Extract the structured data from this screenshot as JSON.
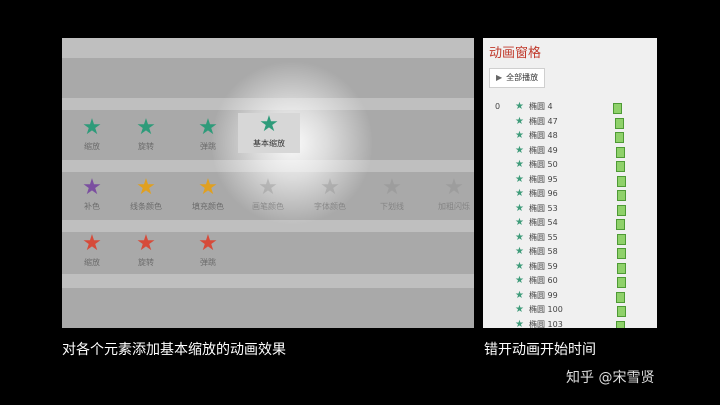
{
  "gallery": {
    "rows": [
      [
        {
          "label": "缩放",
          "color": "#2e9b7a"
        },
        {
          "label": "旋转",
          "color": "#2e9b7a"
        },
        {
          "label": "弹跳",
          "color": "#2e9b7a"
        }
      ],
      [
        {
          "label": "补色",
          "color": "#7b4fa0"
        },
        {
          "label": "线条颜色",
          "color": "#e0a020"
        },
        {
          "label": "填充颜色",
          "color": "#e0a020"
        },
        {
          "label": "画笔颜色",
          "color": "#888888"
        },
        {
          "label": "字体颜色",
          "color": "#888888"
        },
        {
          "label": "下划线",
          "color": "#888888"
        },
        {
          "label": "加粗闪烁",
          "color": "#888888"
        }
      ],
      [
        {
          "label": "缩放",
          "color": "#d64b3a"
        },
        {
          "label": "旋转",
          "color": "#d64b3a"
        },
        {
          "label": "弹跳",
          "color": "#d64b3a"
        }
      ]
    ],
    "highlighted": {
      "label": "基本缩放",
      "color": "#2e9b7a"
    }
  },
  "animation_pane": {
    "title": "动画窗格",
    "play_all": "全部播放",
    "items": [
      {
        "num": "0",
        "name": "椭圆 4",
        "bar": 0.05
      },
      {
        "num": "",
        "name": "椭圆 47",
        "bar": 0.1
      },
      {
        "num": "",
        "name": "椭圆 48",
        "bar": 0.1
      },
      {
        "num": "",
        "name": "椭圆 49",
        "bar": 0.12
      },
      {
        "num": "",
        "name": "椭圆 50",
        "bar": 0.12
      },
      {
        "num": "",
        "name": "椭圆 95",
        "bar": 0.14
      },
      {
        "num": "",
        "name": "椭圆 96",
        "bar": 0.16
      },
      {
        "num": "",
        "name": "椭圆 53",
        "bar": 0.14
      },
      {
        "num": "",
        "name": "椭圆 54",
        "bar": 0.12
      },
      {
        "num": "",
        "name": "椭圆 55",
        "bar": 0.14
      },
      {
        "num": "",
        "name": "椭圆 58",
        "bar": 0.16
      },
      {
        "num": "",
        "name": "椭圆 59",
        "bar": 0.14
      },
      {
        "num": "",
        "name": "椭圆 60",
        "bar": 0.16
      },
      {
        "num": "",
        "name": "椭圆 99",
        "bar": 0.12
      },
      {
        "num": "",
        "name": "椭圆 100",
        "bar": 0.14
      },
      {
        "num": "",
        "name": "椭圆 103",
        "bar": 0.12
      }
    ]
  },
  "captions": {
    "left": "对各个元素添加基本缩放的动画效果",
    "right": "错开动画开始时间",
    "watermark": "知乎 @宋雪贤"
  }
}
